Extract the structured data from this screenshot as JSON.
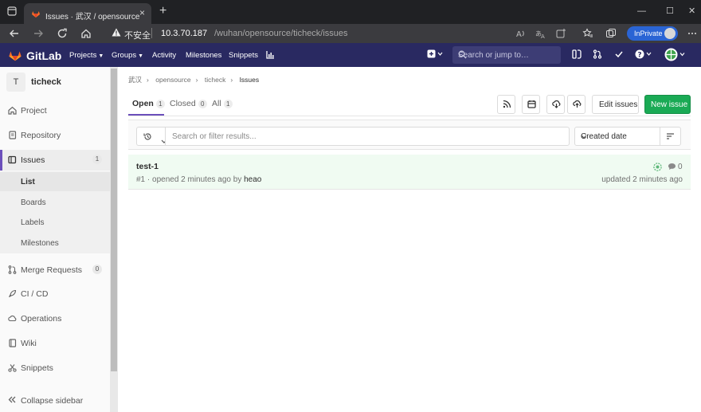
{
  "browser": {
    "tab_title": "Issues · 武汉 / opensource / ticheck",
    "insecure_label": "不安全",
    "url_host": "10.3.70.187",
    "url_path": "/wuhan/opensource/ticheck/issues",
    "inprivate_label": "InPrivate"
  },
  "header": {
    "brand": "GitLab",
    "nav": [
      "Projects",
      "Groups",
      "Activity",
      "Milestones",
      "Snippets"
    ],
    "search_placeholder": "Search or jump to…"
  },
  "sidebar": {
    "project_initial": "T",
    "project_name": "ticheck",
    "items": [
      {
        "label": "Project",
        "icon": "home-icon"
      },
      {
        "label": "Repository",
        "icon": "doc-icon"
      },
      {
        "label": "Issues",
        "icon": "issues-icon",
        "count": "1"
      },
      {
        "label": "Merge Requests",
        "icon": "merge-request-icon",
        "count": "0"
      },
      {
        "label": "CI / CD",
        "icon": "rocket-icon"
      },
      {
        "label": "Operations",
        "icon": "cloud-gear-icon"
      },
      {
        "label": "Wiki",
        "icon": "book-icon"
      },
      {
        "label": "Snippets",
        "icon": "scissors-icon"
      }
    ],
    "issues_sub": [
      "List",
      "Boards",
      "Labels",
      "Milestones"
    ],
    "collapse_label": "Collapse sidebar"
  },
  "breadcrumb": [
    "武汉",
    "opensource",
    "ticheck",
    "Issues"
  ],
  "tabs": [
    {
      "label": "Open",
      "count": "1"
    },
    {
      "label": "Closed",
      "count": "0"
    },
    {
      "label": "All",
      "count": "1"
    }
  ],
  "actions": {
    "edit_issues": "Edit issues",
    "new_issue": "New issue"
  },
  "filter": {
    "placeholder": "Search or filter results...",
    "sort_label": "Created date"
  },
  "issues": [
    {
      "title": "test-1",
      "meta_prefix": "#1 · opened 2 minutes ago by",
      "author": "heao",
      "comments": "0",
      "updated": "updated 2 minutes ago"
    }
  ],
  "colors": {
    "header_bg": "#292961",
    "accent": "#6b4fbb",
    "new_button": "#1aaa55",
    "issue_row_bg": "#f0fbf2"
  }
}
